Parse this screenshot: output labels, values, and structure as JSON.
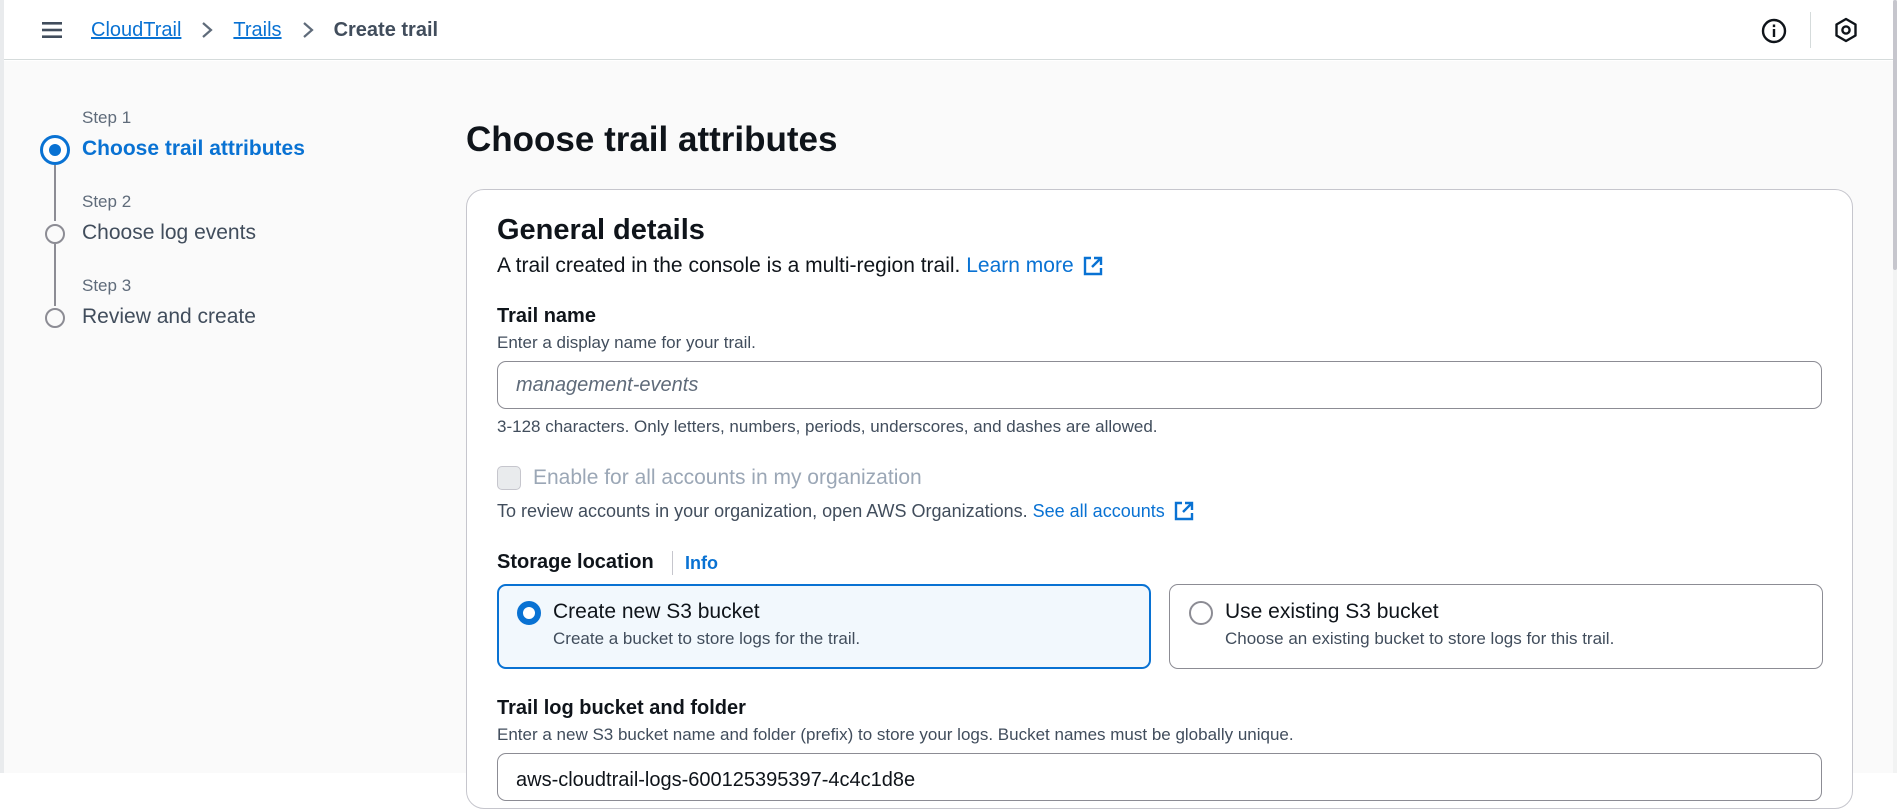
{
  "breadcrumb": {
    "items": [
      "CloudTrail",
      "Trails"
    ],
    "current": "Create trail"
  },
  "top_icons": [
    "info-icon",
    "hexagon-settings-icon"
  ],
  "wizard": {
    "steps": [
      {
        "step_label": "Step 1",
        "title": "Choose trail attributes",
        "active": true
      },
      {
        "step_label": "Step 2",
        "title": "Choose log events",
        "active": false
      },
      {
        "step_label": "Step 3",
        "title": "Review and create",
        "active": false
      }
    ]
  },
  "page": {
    "title": "Choose trail attributes"
  },
  "general": {
    "title": "General details",
    "description": "A trail created in the console is a multi-region trail.",
    "learn_more": "Learn more"
  },
  "trail_name": {
    "label": "Trail name",
    "description": "Enter a display name for your trail.",
    "placeholder": "management-events",
    "value": "",
    "constraint": "3-128 characters. Only letters, numbers, periods, underscores, and dashes are allowed."
  },
  "organization": {
    "checkbox_label": "Enable for all accounts in my organization",
    "checked": false,
    "disabled": true,
    "text": "To review accounts in your organization, open AWS Organizations.",
    "link": "See all accounts"
  },
  "storage": {
    "label": "Storage location",
    "info": "Info",
    "options": [
      {
        "title": "Create new S3 bucket",
        "description": "Create a bucket to store logs for the trail.",
        "selected": true
      },
      {
        "title": "Use existing S3 bucket",
        "description": "Choose an existing bucket to store logs for this trail.",
        "selected": false
      }
    ]
  },
  "bucket": {
    "label": "Trail log bucket and folder",
    "description": "Enter a new S3 bucket name and folder (prefix) to store your logs. Bucket names must be globally unique.",
    "value": "aws-cloudtrail-logs-600125395397-4c4c1d8e"
  },
  "colors": {
    "accent": "#0972d3",
    "selected_tile_bg": "#f2f8fd",
    "text": "#0f141a",
    "muted": "#414d5c"
  }
}
